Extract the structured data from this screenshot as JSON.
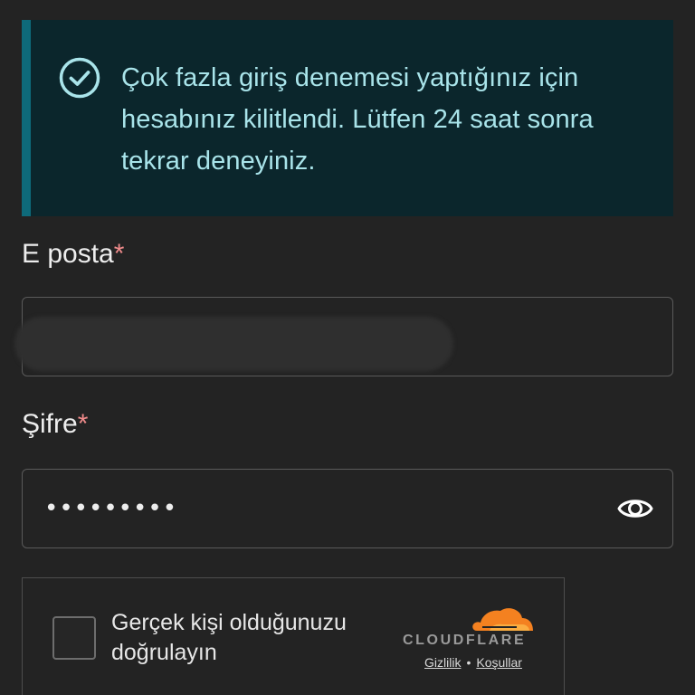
{
  "alert": {
    "icon": "check-circle-icon",
    "message": "Çok fazla giriş denemesi yaptığınız için hesabınız kilitlendi. Lütfen 24 saat sonra tekrar deneyiniz.",
    "accent_color": "#0e6a7a",
    "background_color": "#0b262c",
    "text_color": "#a9e4ea"
  },
  "email": {
    "label": "E posta",
    "required_mark": "*",
    "value": ""
  },
  "password": {
    "label": "Şifre",
    "required_mark": "*",
    "value": "•••••••••",
    "toggle_icon": "eye-icon"
  },
  "captcha": {
    "label": "Gerçek kişi olduğunuzu doğrulayın",
    "brand": "CLOUDFLARE",
    "privacy_link": "Gizlilik",
    "separator": "•",
    "terms_link": "Koşullar",
    "brand_color": "#f48120"
  },
  "colors": {
    "background": "#232323",
    "required": "#f08b8b",
    "border": "#5a5a5a"
  }
}
